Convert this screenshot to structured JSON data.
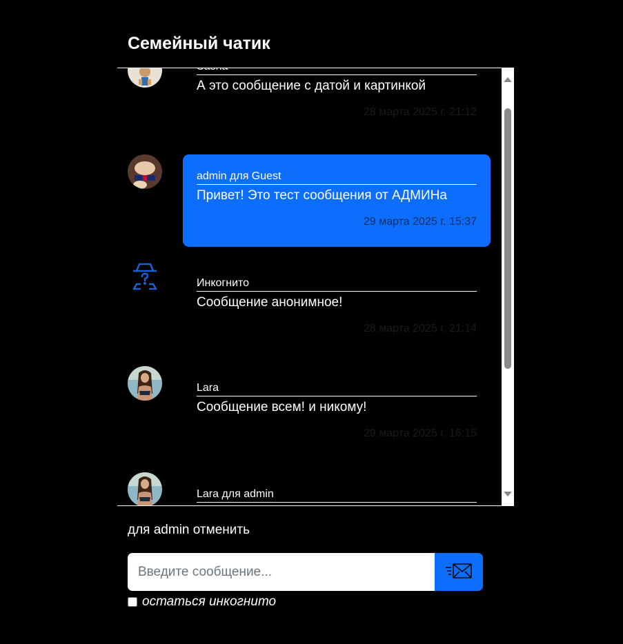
{
  "chat": {
    "title": "Семейный чатик",
    "messages": [
      {
        "author": "Sasha",
        "text": "А это сообщение с датой и картинкой",
        "time": "28 марта 2025 г. 21:12",
        "avatar": "avatar-sasha",
        "own": false
      },
      {
        "author": "admin для Guest",
        "text": "Привет! Это тест сообщения от АДМИНа",
        "time": "29 марта 2025 г. 15:37",
        "avatar": "avatar-admin",
        "own": true
      },
      {
        "author": "Инкогнито",
        "text": "Сообщение анонимное!",
        "time": "28 марта 2025 г. 21:14",
        "avatar": "incognito-icon",
        "own": false
      },
      {
        "author": "Lara",
        "text": "Сообщение всем! и никому!",
        "time": "29 марта 2025 г. 16:15",
        "avatar": "avatar-lara",
        "own": false
      },
      {
        "author": "Lara для admin",
        "text": "",
        "time": "",
        "avatar": "avatar-lara",
        "own": false
      }
    ]
  },
  "reply": {
    "prefix": "для admin",
    "cancel_label": "отменить"
  },
  "composer": {
    "placeholder": "Введите сообщение...",
    "value": "",
    "send_icon": "send-mail-icon",
    "incognito_label": "остаться инкогнито",
    "incognito_checked": false
  },
  "colors": {
    "background": "#000000",
    "accent": "#0d6efd",
    "text": "#ffffff"
  }
}
